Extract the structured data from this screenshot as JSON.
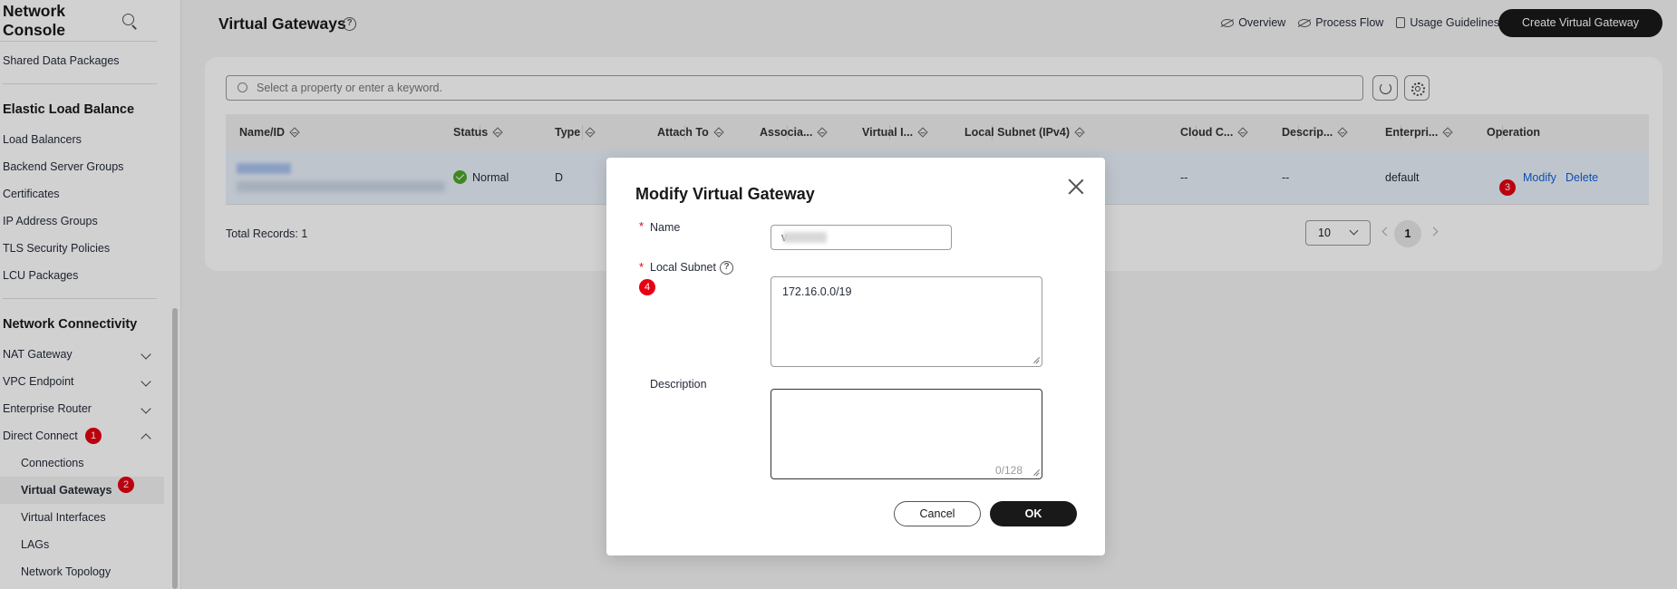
{
  "sidebar": {
    "title": "Network Console",
    "top_items": [
      {
        "label": "Shared Data Packages"
      }
    ],
    "section_elb": "Elastic Load Balance",
    "elb_items": [
      {
        "label": "Load Balancers"
      },
      {
        "label": "Backend Server Groups"
      },
      {
        "label": "Certificates"
      },
      {
        "label": "IP Address Groups"
      },
      {
        "label": "TLS Security Policies"
      },
      {
        "label": "LCU Packages"
      }
    ],
    "section_nc": "Network Connectivity",
    "nc_items": [
      {
        "label": "NAT Gateway"
      },
      {
        "label": "VPC Endpoint"
      },
      {
        "label": "Enterprise Router"
      },
      {
        "label": "Direct Connect",
        "badge": "1"
      }
    ],
    "dc_subitems": [
      {
        "label": "Connections"
      },
      {
        "label": "Virtual Gateways",
        "badge": "2"
      },
      {
        "label": "Virtual Interfaces"
      },
      {
        "label": "LAGs"
      },
      {
        "label": "Network Topology"
      }
    ]
  },
  "header": {
    "title": "Virtual Gateways",
    "help_glyph": "?",
    "links": [
      "Overview",
      "Process Flow",
      "Usage Guidelines"
    ],
    "create_button": "Create Virtual Gateway"
  },
  "search": {
    "placeholder": "Select a property or enter a keyword."
  },
  "table": {
    "columns": [
      "Name/ID",
      "Status",
      "Type",
      "Attach To",
      "Associa...",
      "Virtual I...",
      "Local Subnet (IPv4)",
      "Cloud C...",
      "Descrip...",
      "Enterpri...",
      "Operation"
    ],
    "row": {
      "status": "Normal",
      "type": "D",
      "cloud_connection": "--",
      "description": "--",
      "enterprise_project": "default",
      "op_badge": "3",
      "op_modify": "Modify",
      "op_delete": "Delete"
    },
    "total_records": "Total Records: 1",
    "page_size": "10",
    "current_page": "1"
  },
  "modal": {
    "title": "Modify Virtual Gateway",
    "required_marker": "*",
    "name_label": "Name",
    "name_value": "v",
    "local_subnet_label": "Local Subnet",
    "local_subnet_badge": "4",
    "local_subnet_value": "172.16.0.0/19",
    "description_label": "Description",
    "description_value": "",
    "description_counter": "0/128",
    "cancel_label": "Cancel",
    "ok_label": "OK"
  },
  "colors": {
    "badge": "#e60012",
    "link": "#0e5fd8",
    "primary_button": "#191919",
    "status_normal": "#4ca62a"
  }
}
